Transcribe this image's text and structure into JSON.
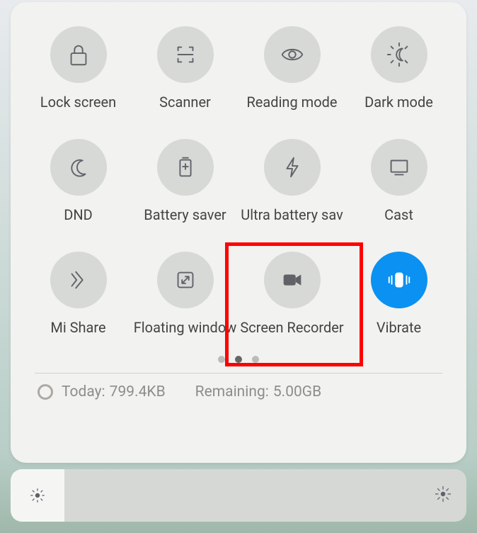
{
  "tiles": {
    "lock": {
      "label": "Lock screen"
    },
    "scanner": {
      "label": "Scanner"
    },
    "reading": {
      "label": "Reading mode"
    },
    "dark": {
      "label": "Dark mode"
    },
    "dnd": {
      "label": "DND"
    },
    "battery": {
      "label": "Battery saver"
    },
    "ultra": {
      "label": "Ultra battery sav"
    },
    "cast": {
      "label": "Cast"
    },
    "mishare": {
      "label": "Mi Share"
    },
    "floating": {
      "label": "Floating window"
    },
    "recorder": {
      "label": "Screen Recorder"
    },
    "vibrate": {
      "label": "Vibrate",
      "active": true
    }
  },
  "pagination": {
    "count": 3,
    "activeIndex": 1
  },
  "statusbar": {
    "today_label": "Today:",
    "today_value": "799.4KB",
    "remaining_label": "Remaining:",
    "remaining_value": "5.00GB"
  },
  "highlight": {
    "target": "recorder"
  },
  "colors": {
    "accent": "#0a91f1",
    "highlight": "#ff0000"
  }
}
